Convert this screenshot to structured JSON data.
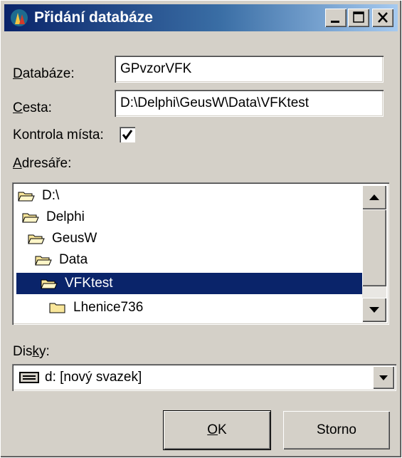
{
  "window": {
    "title": "Přidání databáze",
    "title_bar_color": "#0a246a",
    "face_color": "#d4d0c8",
    "controls": [
      "minimize-icon",
      "maximize-icon",
      "close-icon"
    ]
  },
  "form": {
    "database_label_pre": "",
    "database_label_key": "D",
    "database_label_post": "atabáze:",
    "database_value": "GPvzorVFK",
    "path_label_pre": "",
    "path_label_key": "C",
    "path_label_post": "esta:",
    "path_value": "D:\\Delphi\\GeusW\\Data\\VFKtest",
    "check_label": "Kontrola místa:",
    "check_checked": true,
    "dirs_label_pre": "",
    "dirs_label_key": "A",
    "dirs_label_post": "dresáře:",
    "drives_label_pre": "Dis",
    "drives_label_key": "k",
    "drives_label_post": "y:"
  },
  "directories": [
    {
      "name": "D:\\",
      "icon": "open-folder-icon",
      "selected": false
    },
    {
      "name": "Delphi",
      "icon": "open-folder-icon",
      "selected": false
    },
    {
      "name": "GeusW",
      "icon": "open-folder-icon",
      "selected": false
    },
    {
      "name": "Data",
      "icon": "open-folder-icon",
      "selected": false
    },
    {
      "name": "VFKtest",
      "icon": "open-folder-icon",
      "selected": true
    },
    {
      "name": "Lhenice736",
      "icon": "closed-folder-icon",
      "selected": false
    }
  ],
  "drives": {
    "selected": "d: [nový svazek]",
    "icon": "drive-icon"
  },
  "buttons": {
    "ok_pre": "",
    "ok_key": "O",
    "ok_post": "K",
    "cancel": "Storno"
  },
  "selection_color": "#0a246a"
}
